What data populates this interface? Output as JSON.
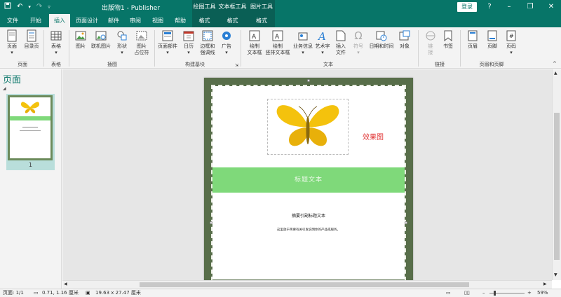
{
  "titlebar": {
    "title": "出版物1  -  Publisher",
    "context_groups": [
      "绘图工具",
      "文本框工具",
      "图片工具"
    ],
    "login": "登录",
    "help": "?",
    "minimize": "–",
    "restore": "❐",
    "close": "✕"
  },
  "tabs": [
    "文件",
    "开始",
    "插入",
    "页面设计",
    "邮件",
    "审阅",
    "视图",
    "帮助",
    "格式",
    "格式",
    "格式"
  ],
  "ribbon": {
    "pages": {
      "page": "页面",
      "toc": "目录页",
      "group": "页面"
    },
    "tables": {
      "table": "表格",
      "group": "表格"
    },
    "illustrations": {
      "picture": "图片",
      "online": "联机图片",
      "shapes": "形状",
      "placeholder1": "图片",
      "placeholder2": "占位符",
      "group": "插图"
    },
    "blocks": {
      "parts": "页面部件",
      "calendar": "日历",
      "border1": "边框和",
      "border2": "强调线",
      "ad": "广告",
      "group": "构建基块"
    },
    "text": {
      "tb1": "绘制",
      "tb2": "文本框",
      "vtb1": "绘制",
      "vtb2": "竖排文本框",
      "biz": "业务信息",
      "wordart": "艺术字",
      "insfile1": "插入",
      "insfile2": "文件",
      "symbol": "符号",
      "datetime": "日期和时间",
      "object": "对象",
      "group": "文本"
    },
    "links": {
      "link1": "链",
      "link2": "接",
      "bookmark": "书签",
      "group": "链接"
    },
    "hf": {
      "header": "页眉",
      "footer": "页脚",
      "pagenum": "页码",
      "group": "页眉和页脚"
    }
  },
  "pane": {
    "title": "页面",
    "page_number": "1"
  },
  "page": {
    "banner_text": "标题文本",
    "effect_label": "效果图",
    "subtitle": "摘要引副标题文本",
    "description": "这里放于简要有关引发说明你的产品或服务。"
  },
  "statusbar": {
    "page": "页面: 1/1",
    "position": "0.71, 1.16 厘米",
    "size": "19.63 x 27.47 厘米",
    "zoom": "59%"
  },
  "colors": {
    "brand": "#077568",
    "banner": "#7fd97a",
    "border": "#586e4a",
    "effect": "#e03030"
  }
}
